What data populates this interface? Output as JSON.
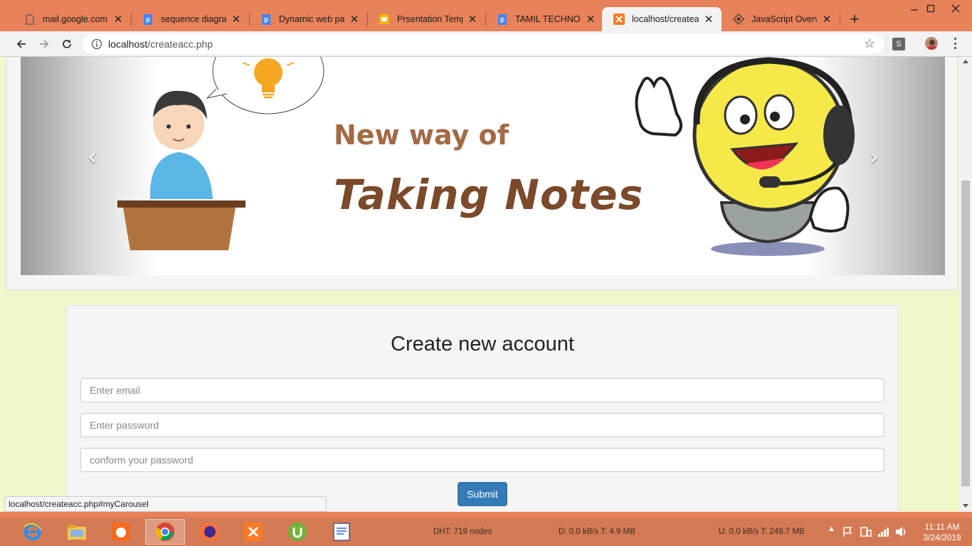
{
  "browser": {
    "tabs": [
      {
        "title": "mail.google.com",
        "icon": "page-icon"
      },
      {
        "title": "sequence diagram",
        "icon": "google-doc-icon"
      },
      {
        "title": "Dynamic web page",
        "icon": "google-doc-icon"
      },
      {
        "title": "Prsentation Templa",
        "icon": "google-slides-icon"
      },
      {
        "title": "TAMIL TECHNO-LE",
        "icon": "google-doc-icon"
      },
      {
        "title": "localhost/createacc",
        "icon": "xampp-icon"
      },
      {
        "title": "JavaScript Overview",
        "icon": "diamond-icon"
      }
    ],
    "active_tab": 5,
    "url_host": "localhost",
    "url_path": "/createacc.php",
    "profile_initial": "S"
  },
  "carousel": {
    "line1": "New way of",
    "line2": "Taking Notes"
  },
  "form": {
    "heading": "Create new account",
    "email_placeholder": "Enter email",
    "password_placeholder": "Enter password",
    "confirm_placeholder": "conform your password",
    "submit_label": "Submit"
  },
  "status_url": "localhost/createacc.php#myCarousel",
  "taskbar": {
    "dht": "DHT: 719 nodes",
    "download": "D: 0.0 kB/s T: 4.9 MB",
    "upload": "U: 0.0 kB/s T: 249.7 MB",
    "time": "11:11 AM",
    "date": "3/24/2019"
  },
  "colors": {
    "chrome_frame": "#e8825a",
    "page_bg": "#f0f8cc",
    "submit_bg": "#337ab7",
    "title_brown": "#7a4a2a"
  }
}
